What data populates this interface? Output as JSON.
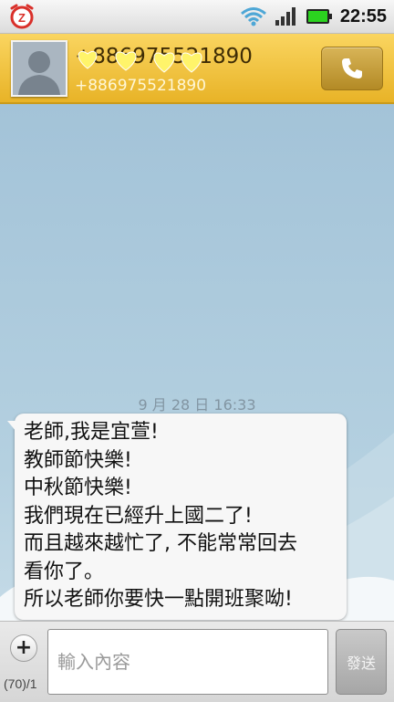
{
  "status_bar": {
    "time": "22:55",
    "icons": [
      "app-notification-icon",
      "wifi-icon",
      "signal-icon",
      "battery-icon"
    ]
  },
  "contact": {
    "name": "+886975521890",
    "number": "+886975521890",
    "avatar_icon": "person-silhouette-icon",
    "call_icon": "phone-icon"
  },
  "conversation": {
    "timestamp": "9 月 28 日 16:33",
    "message": {
      "lines": [
        "老師,我是宜萱!",
        "教師節快樂!",
        "中秋節快樂!",
        "我們現在已經升上國二了!",
        "而且越來越忙了, 不能常常回去",
        "看你了。",
        "所以老師你要快一點開班聚呦!"
      ]
    }
  },
  "compose": {
    "placeholder": "輸入內容",
    "value": "",
    "counter": "(70)/1",
    "send_label": "發送",
    "attach_label": "+"
  },
  "colors": {
    "header_accent": "#f2c23c",
    "conversation_bg": "#a9c8da",
    "bubble_bg": "#f7f7f7"
  }
}
